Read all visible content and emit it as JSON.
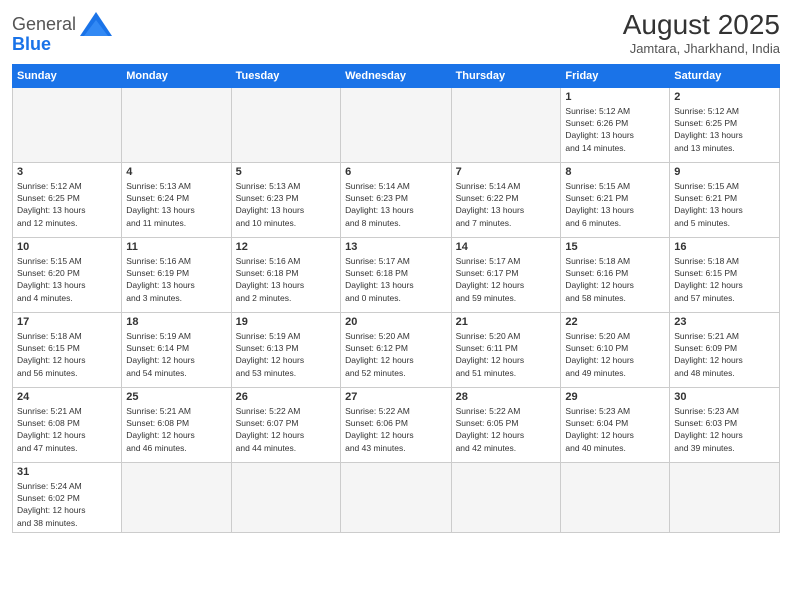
{
  "header": {
    "logo_text_general": "General",
    "logo_text_blue": "Blue",
    "month_title": "August 2025",
    "location": "Jamtara, Jharkhand, India"
  },
  "weekdays": [
    "Sunday",
    "Monday",
    "Tuesday",
    "Wednesday",
    "Thursday",
    "Friday",
    "Saturday"
  ],
  "days": [
    {
      "num": "",
      "info": ""
    },
    {
      "num": "",
      "info": ""
    },
    {
      "num": "",
      "info": ""
    },
    {
      "num": "",
      "info": ""
    },
    {
      "num": "",
      "info": ""
    },
    {
      "num": "1",
      "info": "Sunrise: 5:12 AM\nSunset: 6:26 PM\nDaylight: 13 hours\nand 14 minutes."
    },
    {
      "num": "2",
      "info": "Sunrise: 5:12 AM\nSunset: 6:25 PM\nDaylight: 13 hours\nand 13 minutes."
    },
    {
      "num": "3",
      "info": "Sunrise: 5:12 AM\nSunset: 6:25 PM\nDaylight: 13 hours\nand 12 minutes."
    },
    {
      "num": "4",
      "info": "Sunrise: 5:13 AM\nSunset: 6:24 PM\nDaylight: 13 hours\nand 11 minutes."
    },
    {
      "num": "5",
      "info": "Sunrise: 5:13 AM\nSunset: 6:23 PM\nDaylight: 13 hours\nand 10 minutes."
    },
    {
      "num": "6",
      "info": "Sunrise: 5:14 AM\nSunset: 6:23 PM\nDaylight: 13 hours\nand 8 minutes."
    },
    {
      "num": "7",
      "info": "Sunrise: 5:14 AM\nSunset: 6:22 PM\nDaylight: 13 hours\nand 7 minutes."
    },
    {
      "num": "8",
      "info": "Sunrise: 5:15 AM\nSunset: 6:21 PM\nDaylight: 13 hours\nand 6 minutes."
    },
    {
      "num": "9",
      "info": "Sunrise: 5:15 AM\nSunset: 6:21 PM\nDaylight: 13 hours\nand 5 minutes."
    },
    {
      "num": "10",
      "info": "Sunrise: 5:15 AM\nSunset: 6:20 PM\nDaylight: 13 hours\nand 4 minutes."
    },
    {
      "num": "11",
      "info": "Sunrise: 5:16 AM\nSunset: 6:19 PM\nDaylight: 13 hours\nand 3 minutes."
    },
    {
      "num": "12",
      "info": "Sunrise: 5:16 AM\nSunset: 6:18 PM\nDaylight: 13 hours\nand 2 minutes."
    },
    {
      "num": "13",
      "info": "Sunrise: 5:17 AM\nSunset: 6:18 PM\nDaylight: 13 hours\nand 0 minutes."
    },
    {
      "num": "14",
      "info": "Sunrise: 5:17 AM\nSunset: 6:17 PM\nDaylight: 12 hours\nand 59 minutes."
    },
    {
      "num": "15",
      "info": "Sunrise: 5:18 AM\nSunset: 6:16 PM\nDaylight: 12 hours\nand 58 minutes."
    },
    {
      "num": "16",
      "info": "Sunrise: 5:18 AM\nSunset: 6:15 PM\nDaylight: 12 hours\nand 57 minutes."
    },
    {
      "num": "17",
      "info": "Sunrise: 5:18 AM\nSunset: 6:15 PM\nDaylight: 12 hours\nand 56 minutes."
    },
    {
      "num": "18",
      "info": "Sunrise: 5:19 AM\nSunset: 6:14 PM\nDaylight: 12 hours\nand 54 minutes."
    },
    {
      "num": "19",
      "info": "Sunrise: 5:19 AM\nSunset: 6:13 PM\nDaylight: 12 hours\nand 53 minutes."
    },
    {
      "num": "20",
      "info": "Sunrise: 5:20 AM\nSunset: 6:12 PM\nDaylight: 12 hours\nand 52 minutes."
    },
    {
      "num": "21",
      "info": "Sunrise: 5:20 AM\nSunset: 6:11 PM\nDaylight: 12 hours\nand 51 minutes."
    },
    {
      "num": "22",
      "info": "Sunrise: 5:20 AM\nSunset: 6:10 PM\nDaylight: 12 hours\nand 49 minutes."
    },
    {
      "num": "23",
      "info": "Sunrise: 5:21 AM\nSunset: 6:09 PM\nDaylight: 12 hours\nand 48 minutes."
    },
    {
      "num": "24",
      "info": "Sunrise: 5:21 AM\nSunset: 6:08 PM\nDaylight: 12 hours\nand 47 minutes."
    },
    {
      "num": "25",
      "info": "Sunrise: 5:21 AM\nSunset: 6:08 PM\nDaylight: 12 hours\nand 46 minutes."
    },
    {
      "num": "26",
      "info": "Sunrise: 5:22 AM\nSunset: 6:07 PM\nDaylight: 12 hours\nand 44 minutes."
    },
    {
      "num": "27",
      "info": "Sunrise: 5:22 AM\nSunset: 6:06 PM\nDaylight: 12 hours\nand 43 minutes."
    },
    {
      "num": "28",
      "info": "Sunrise: 5:22 AM\nSunset: 6:05 PM\nDaylight: 12 hours\nand 42 minutes."
    },
    {
      "num": "29",
      "info": "Sunrise: 5:23 AM\nSunset: 6:04 PM\nDaylight: 12 hours\nand 40 minutes."
    },
    {
      "num": "30",
      "info": "Sunrise: 5:23 AM\nSunset: 6:03 PM\nDaylight: 12 hours\nand 39 minutes."
    },
    {
      "num": "31",
      "info": "Sunrise: 5:24 AM\nSunset: 6:02 PM\nDaylight: 12 hours\nand 38 minutes."
    }
  ]
}
